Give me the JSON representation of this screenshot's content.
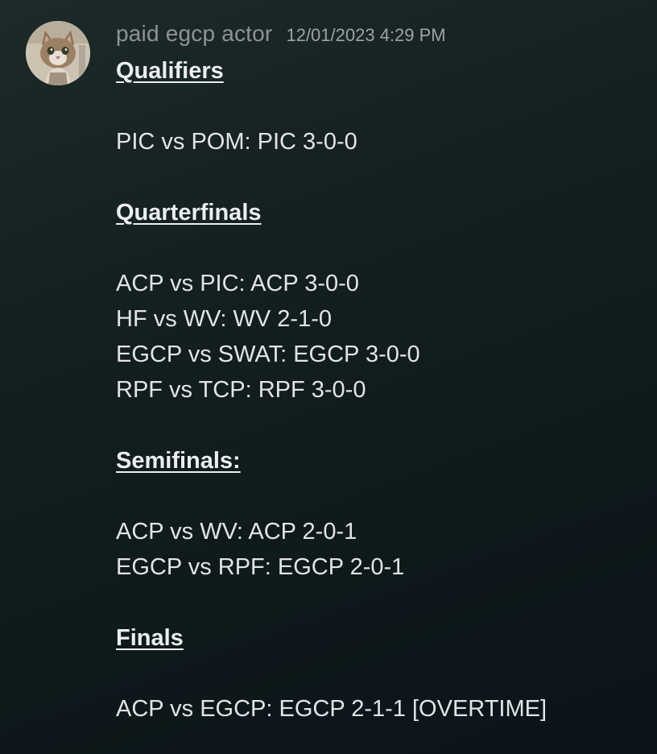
{
  "message": {
    "author": "paid egcp actor",
    "timestamp": "12/01/2023 4:29 PM",
    "avatar_icon": "cat-avatar-icon",
    "lines": [
      {
        "kind": "heading",
        "text": "Qualifiers"
      },
      {
        "kind": "blank",
        "text": ""
      },
      {
        "kind": "text",
        "text": "PIC vs POM: PIC 3-0-0"
      },
      {
        "kind": "blank",
        "text": ""
      },
      {
        "kind": "heading",
        "text": "Quarterfinals"
      },
      {
        "kind": "blank",
        "text": ""
      },
      {
        "kind": "text",
        "text": "ACP vs PIC: ACP 3-0-0"
      },
      {
        "kind": "text",
        "text": "HF vs WV: WV 2-1-0"
      },
      {
        "kind": "text",
        "text": "EGCP vs SWAT: EGCP 3-0-0"
      },
      {
        "kind": "text",
        "text": "RPF vs TCP: RPF 3-0-0"
      },
      {
        "kind": "blank",
        "text": ""
      },
      {
        "kind": "heading",
        "text": "Semifinals:"
      },
      {
        "kind": "blank",
        "text": ""
      },
      {
        "kind": "text",
        "text": "ACP vs WV: ACP 2-0-1"
      },
      {
        "kind": "text",
        "text": "EGCP vs RPF: EGCP 2-0-1"
      },
      {
        "kind": "blank",
        "text": ""
      },
      {
        "kind": "heading",
        "text": "Finals"
      },
      {
        "kind": "blank",
        "text": ""
      },
      {
        "kind": "text",
        "text": "ACP vs EGCP: EGCP 2-1-1 [OVERTIME]"
      }
    ]
  }
}
